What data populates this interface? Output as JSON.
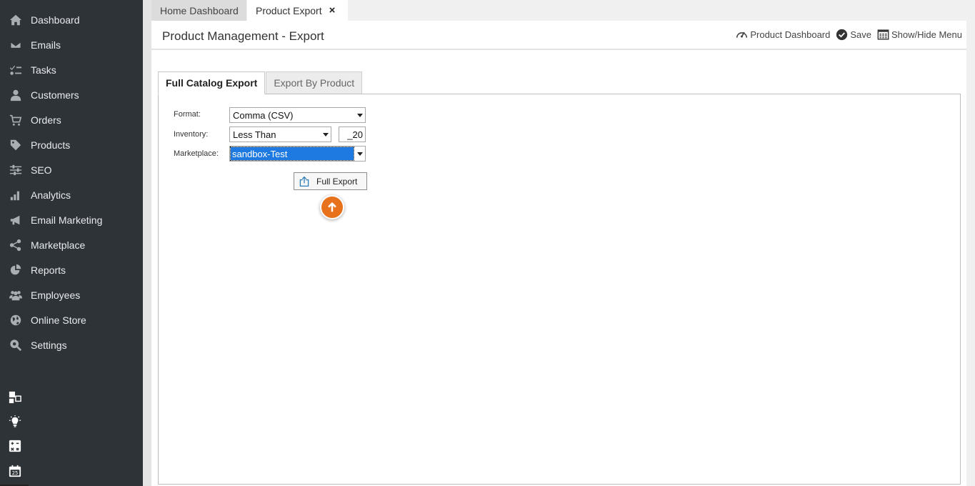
{
  "sidebar": {
    "items": [
      {
        "label": "Dashboard",
        "icon": "home-icon"
      },
      {
        "label": "Emails",
        "icon": "envelope-icon"
      },
      {
        "label": "Tasks",
        "icon": "tasks-icon"
      },
      {
        "label": "Customers",
        "icon": "user-icon"
      },
      {
        "label": "Orders",
        "icon": "cart-icon"
      },
      {
        "label": "Products",
        "icon": "tag-icon"
      },
      {
        "label": "SEO",
        "icon": "sliders-icon"
      },
      {
        "label": "Analytics",
        "icon": "bar-chart-icon"
      },
      {
        "label": "Email Marketing",
        "icon": "megaphone-icon"
      },
      {
        "label": "Marketplace",
        "icon": "share-icon"
      },
      {
        "label": "Reports",
        "icon": "pie-chart-icon"
      },
      {
        "label": "Employees",
        "icon": "users-icon"
      },
      {
        "label": "Online Store",
        "icon": "globe-icon"
      },
      {
        "label": "Settings",
        "icon": "gear-search-icon"
      }
    ],
    "tools": [
      "windows-icon",
      "lightbulb-icon",
      "calculator-icon",
      "calendar-icon"
    ],
    "calendar_day": "25"
  },
  "tabs": {
    "home": "Home Dashboard",
    "active": "Product Export",
    "close_glyph": "×"
  },
  "header": {
    "title": "Product Management - Export",
    "actions": {
      "dashboard": "Product Dashboard",
      "save": "Save",
      "menu": "Show/Hide Menu"
    }
  },
  "export_tabs": {
    "full": "Full Catalog Export",
    "by_product": "Export By Product"
  },
  "form": {
    "format_label": "Format:",
    "format_value": "Comma (CSV)",
    "inventory_label": "Inventory:",
    "inventory_operator": "Less Than",
    "inventory_value": "_20",
    "marketplace_label": "Marketplace:",
    "marketplace_value": "sandbox-Test",
    "export_button": "Full Export"
  },
  "colors": {
    "sidebar_bg": "#2e3338",
    "accent_orange": "#e8721c",
    "selection_blue": "#1e79e0"
  }
}
